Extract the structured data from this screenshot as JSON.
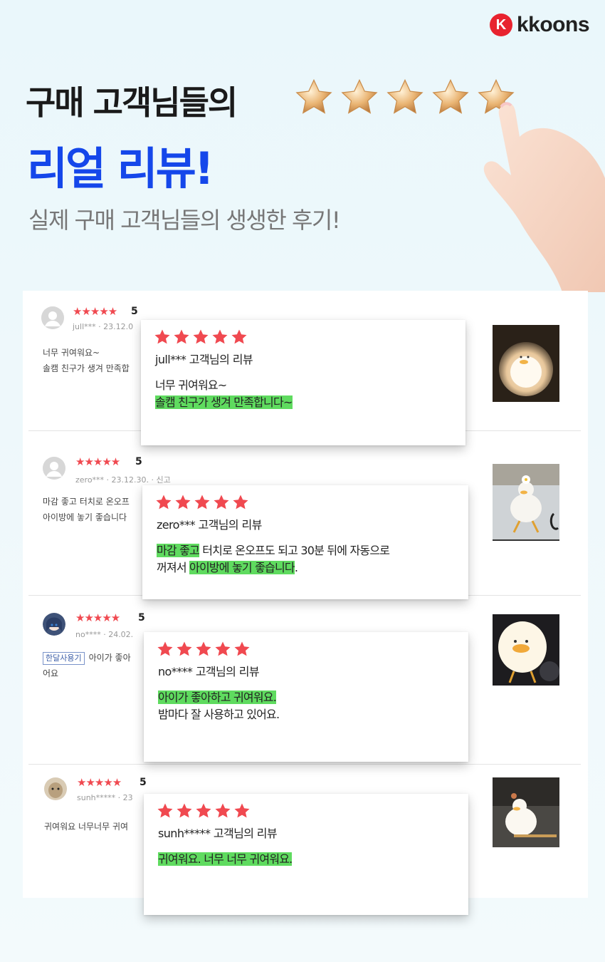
{
  "brand": {
    "logo_letter": "K",
    "name": "kkoons"
  },
  "hero": {
    "title_line1": "구매 고객님들의",
    "title_line2": "리얼 리뷰!",
    "subtitle": "실제 구매 고객님들의 생생한 후기!",
    "star_count": 5,
    "accent_color": "#1547ea"
  },
  "colors": {
    "star": "#f04950",
    "highlight": "#5fdb5f",
    "hero_star": "#e9b06b"
  },
  "reviews": [
    {
      "stars": "★★★★★",
      "score": "5",
      "meta": "jull*** · 23.12.0",
      "text_lines": [
        "너무 귀여워요~",
        "솔캠 친구가 생겨 만족합"
      ],
      "tag": "",
      "card": {
        "user": "jull***  고객님의 리뷰",
        "body_plain_1": "너무 귀여워요~",
        "body_hl_1": "솔캠 친구가 생겨 만족합니다~"
      }
    },
    {
      "stars": "★★★★★",
      "score": "5",
      "meta": "zero*** · 23.12.30. · 신고",
      "text_lines": [
        "마감 좋고 터치로 온오프",
        "아이방에 놓기 좋습니다"
      ],
      "tag": "",
      "card": {
        "user": "zero***  고객님의 리뷰",
        "hl_a": "마감 좋고",
        "plain_a": " 터치로 온오프도 되고 30분 뒤에 자동으로",
        "plain_b": "꺼져서 ",
        "hl_b": "아이방에 놓기 좋습니다",
        "plain_c": "."
      }
    },
    {
      "stars": "★★★★★",
      "score": "5",
      "meta": "no**** · 24.02.",
      "tag": "한달사용기",
      "text_lines": [
        "아이가 좋아",
        "어요"
      ],
      "card": {
        "user": "no****  고객님의 리뷰",
        "hl_a": "아이가 좋아하고 귀여워요.",
        "plain_b": "밤마다 잘 사용하고 있어요."
      }
    },
    {
      "stars": "★★★★★",
      "score": "5",
      "meta": "sunh***** · 23",
      "text_lines": [
        "귀여워요 너무너무 귀여"
      ],
      "tag": "",
      "card": {
        "user": "sunh*****  고객님의 리뷰",
        "hl_a": "귀여워요. 너무 너무 귀여워요. "
      }
    }
  ]
}
